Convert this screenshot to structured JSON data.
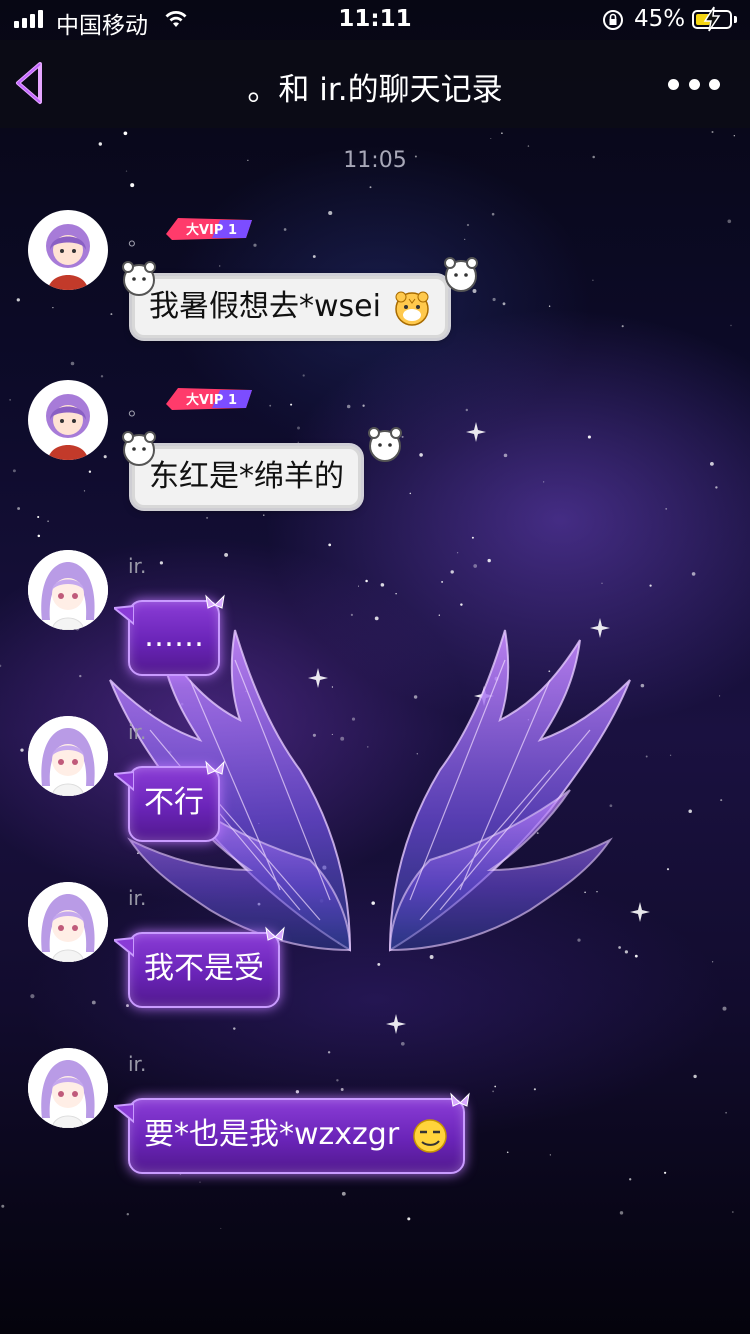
{
  "status_bar": {
    "carrier": "中国移动",
    "time": "11:11",
    "battery_percent": "45%",
    "battery_level": 0.45,
    "charging": true
  },
  "nav": {
    "title": "。和 ir.的聊天记录",
    "back_icon": "back-chevron-icon",
    "more_icon": "more-dots-icon"
  },
  "timestamp": "11:05",
  "messages": [
    {
      "sender": "。",
      "text": "我暑假想去*wsei",
      "emoji": "tiger-face-icon",
      "vip": true,
      "style": "white"
    },
    {
      "sender": "。",
      "text": "东红是*绵羊的",
      "emoji": "",
      "vip": true,
      "style": "white"
    },
    {
      "sender": "ir.",
      "text": "……",
      "emoji": "",
      "vip": false,
      "style": "purple"
    },
    {
      "sender": "ir.",
      "text": "不行",
      "emoji": "",
      "vip": false,
      "style": "purple"
    },
    {
      "sender": "ir.",
      "text": "我不是受",
      "emoji": "",
      "vip": false,
      "style": "purple"
    },
    {
      "sender": "ir.",
      "text": "要*也是我*wzxzgr",
      "emoji": "smirk-face-icon",
      "vip": false,
      "style": "purple"
    }
  ],
  "vip_badge": "大VIP 1",
  "colors": {
    "accent_purple": "#7a2fd0",
    "bubble_white": "#f2f2f2",
    "battery_yellow": "#f5d614",
    "nav_bg": "#0c0c16"
  }
}
